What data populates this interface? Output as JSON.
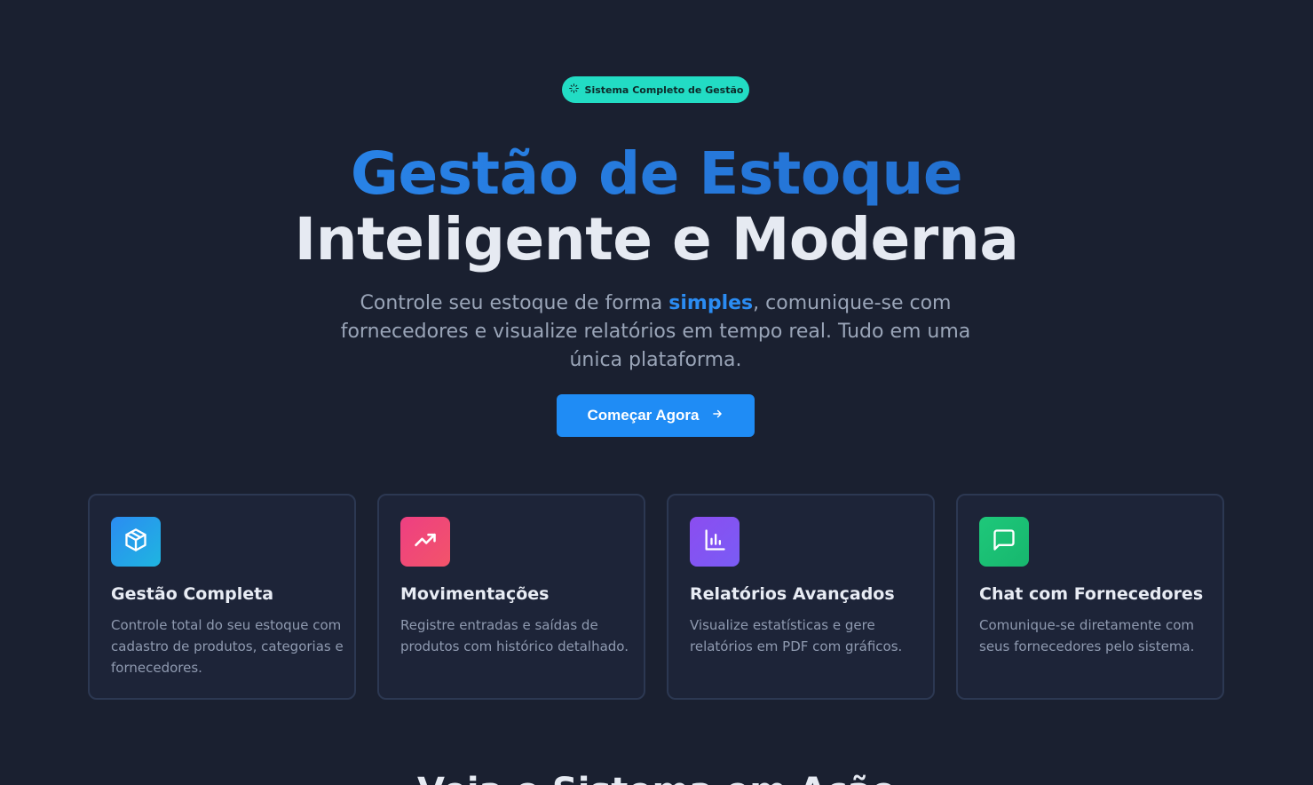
{
  "badge": {
    "icon": "sparkles-icon",
    "label": "Sistema Completo de Gestão"
  },
  "hero": {
    "title_line1": "Gestão de Estoque",
    "title_line2": "Inteligente e Moderna",
    "subtitle_before": "Controle seu estoque de forma ",
    "subtitle_highlight": "simples",
    "subtitle_after": ", comunique-se com fornecedores e visualize relatórios em tempo real. Tudo em uma única plataforma.",
    "cta_label": "Começar Agora",
    "cta_icon": "arrow-right-icon"
  },
  "features": [
    {
      "icon": "box-icon",
      "title": "Gestão Completa",
      "description": "Controle total do seu estoque com cadastro de produtos, categorias e fornecedores.",
      "color_from": "#2b8cf2",
      "color_to": "#1fb5e0"
    },
    {
      "icon": "trending-up-icon",
      "title": "Movimentações",
      "description": "Registre entradas e saídas de produtos com histórico detalhado.",
      "color_from": "#ee3f82",
      "color_to": "#f2546a"
    },
    {
      "icon": "bar-chart-icon",
      "title": "Relatórios Avançados",
      "description": "Visualize estatísticas e gere relatórios em PDF com gráficos.",
      "color_from": "#8b4df0",
      "color_to": "#7a5cf5"
    },
    {
      "icon": "message-square-icon",
      "title": "Chat com Fornecedores",
      "description": "Comunique-se diretamente com seus fornecedores pelo sistema.",
      "color_from": "#1ec87a",
      "color_to": "#17b76e"
    }
  ],
  "next_section": {
    "heading": "Veja o Sistema em Ação"
  },
  "colors": {
    "background": "#1a2030",
    "accent": "#1f8cf5",
    "badge": "#22dcc4",
    "card_border": "#2c3852"
  }
}
